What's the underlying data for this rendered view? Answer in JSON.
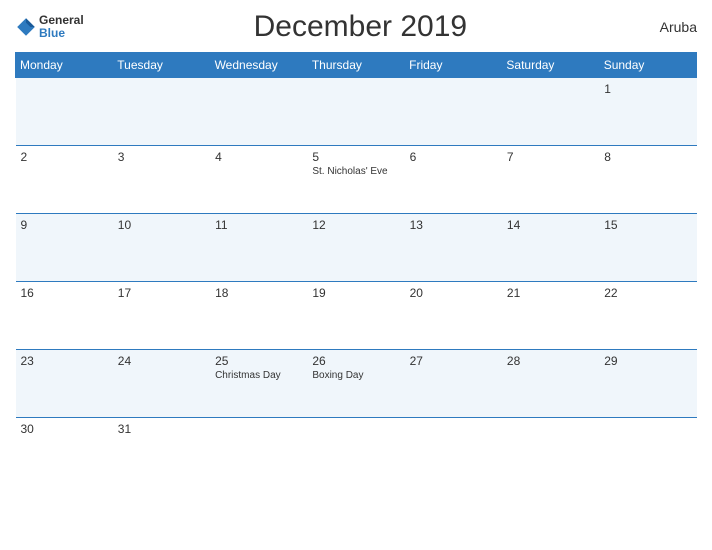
{
  "header": {
    "logo_general": "General",
    "logo_blue": "Blue",
    "title": "December 2019",
    "country": "Aruba"
  },
  "weekdays": [
    "Monday",
    "Tuesday",
    "Wednesday",
    "Thursday",
    "Friday",
    "Saturday",
    "Sunday"
  ],
  "rows": [
    [
      {
        "day": "",
        "holiday": ""
      },
      {
        "day": "",
        "holiday": ""
      },
      {
        "day": "",
        "holiday": ""
      },
      {
        "day": "",
        "holiday": ""
      },
      {
        "day": "",
        "holiday": ""
      },
      {
        "day": "",
        "holiday": ""
      },
      {
        "day": "1",
        "holiday": ""
      }
    ],
    [
      {
        "day": "2",
        "holiday": ""
      },
      {
        "day": "3",
        "holiday": ""
      },
      {
        "day": "4",
        "holiday": ""
      },
      {
        "day": "5",
        "holiday": "St. Nicholas' Eve"
      },
      {
        "day": "6",
        "holiday": ""
      },
      {
        "day": "7",
        "holiday": ""
      },
      {
        "day": "8",
        "holiday": ""
      }
    ],
    [
      {
        "day": "9",
        "holiday": ""
      },
      {
        "day": "10",
        "holiday": ""
      },
      {
        "day": "11",
        "holiday": ""
      },
      {
        "day": "12",
        "holiday": ""
      },
      {
        "day": "13",
        "holiday": ""
      },
      {
        "day": "14",
        "holiday": ""
      },
      {
        "day": "15",
        "holiday": ""
      }
    ],
    [
      {
        "day": "16",
        "holiday": ""
      },
      {
        "day": "17",
        "holiday": ""
      },
      {
        "day": "18",
        "holiday": ""
      },
      {
        "day": "19",
        "holiday": ""
      },
      {
        "day": "20",
        "holiday": ""
      },
      {
        "day": "21",
        "holiday": ""
      },
      {
        "day": "22",
        "holiday": ""
      }
    ],
    [
      {
        "day": "23",
        "holiday": ""
      },
      {
        "day": "24",
        "holiday": ""
      },
      {
        "day": "25",
        "holiday": "Christmas Day"
      },
      {
        "day": "26",
        "holiday": "Boxing Day"
      },
      {
        "day": "27",
        "holiday": ""
      },
      {
        "day": "28",
        "holiday": ""
      },
      {
        "day": "29",
        "holiday": ""
      }
    ],
    [
      {
        "day": "30",
        "holiday": ""
      },
      {
        "day": "31",
        "holiday": ""
      },
      {
        "day": "",
        "holiday": ""
      },
      {
        "day": "",
        "holiday": ""
      },
      {
        "day": "",
        "holiday": ""
      },
      {
        "day": "",
        "holiday": ""
      },
      {
        "day": "",
        "holiday": ""
      }
    ]
  ],
  "accent_color": "#2e7abf"
}
